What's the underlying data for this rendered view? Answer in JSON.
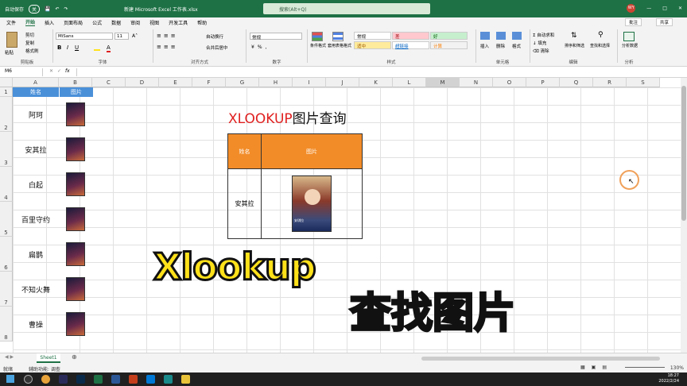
{
  "titlebar": {
    "autosave": "自动保存",
    "autosave_state": "关",
    "doc_title": "新建 Microsoft Excel 工作表.xlsx",
    "search_placeholder": "搜索(Alt+Q)",
    "user_initials": "WY"
  },
  "menu": {
    "tabs": [
      "文件",
      "开始",
      "插入",
      "页面布局",
      "公式",
      "数据",
      "审阅",
      "视图",
      "开发工具",
      "帮助"
    ],
    "active": "开始",
    "comment_btn": "批注",
    "share_btn": "共享"
  },
  "ribbon": {
    "clipboard": {
      "paste": "粘贴",
      "cut": "剪切",
      "copy": "复制",
      "format_painter": "格式刷",
      "label": "剪贴板"
    },
    "font": {
      "name": "MiSans",
      "size": "11",
      "label": "字体"
    },
    "alignment": {
      "wrap": "自动换行",
      "merge": "合并后居中",
      "label": "对齐方式"
    },
    "number": {
      "format": "常规",
      "label": "数字"
    },
    "styles": {
      "cond_format": "条件格式",
      "table_format": "套用表格格式",
      "normal": "常规",
      "bad": "差",
      "good": "好",
      "neutral": "适中",
      "hyperlink": "超链接",
      "calc": "计算",
      "label": "样式"
    },
    "cells": {
      "insert": "插入",
      "delete": "删除",
      "format": "格式",
      "label": "单元格"
    },
    "editing": {
      "autosum": "自动求和",
      "fill": "填充",
      "clear": "清除",
      "sort": "排序和筛选",
      "find": "查找和选择",
      "label": "编辑"
    },
    "analysis": {
      "analyze": "分析数据",
      "label": "分析"
    }
  },
  "formula_bar": {
    "name_box": "M6",
    "fx": "fx",
    "value": ""
  },
  "columns": [
    "A",
    "B",
    "C",
    "D",
    "E",
    "F",
    "G",
    "H",
    "I",
    "J",
    "K",
    "L",
    "M",
    "N",
    "O",
    "P",
    "Q",
    "R",
    "S"
  ],
  "rows": [
    "1",
    "2",
    "3",
    "4",
    "5",
    "6",
    "7",
    "8"
  ],
  "sheet_header": {
    "name_col": "姓名",
    "pic_col": "图片"
  },
  "names": [
    "阿珂",
    "安其拉",
    "白起",
    "百里守约",
    "扁鹊",
    "不知火舞",
    "曹操"
  ],
  "lookup": {
    "title_red": "XLOOKUP",
    "title_black": "图片查询",
    "header_name": "姓名",
    "header_pic": "图片",
    "result_name": "安其拉",
    "result_caption": "安琪拉"
  },
  "overlay": {
    "xlookup": "Xlookup",
    "find_picture": "查找图片"
  },
  "sheet_tab": "Sheet1",
  "status": {
    "ready": "就绪",
    "accessibility": "辅助功能: 调查",
    "zoom": "130%"
  },
  "clock": {
    "time": "18:27",
    "date": "2022/2/24"
  }
}
